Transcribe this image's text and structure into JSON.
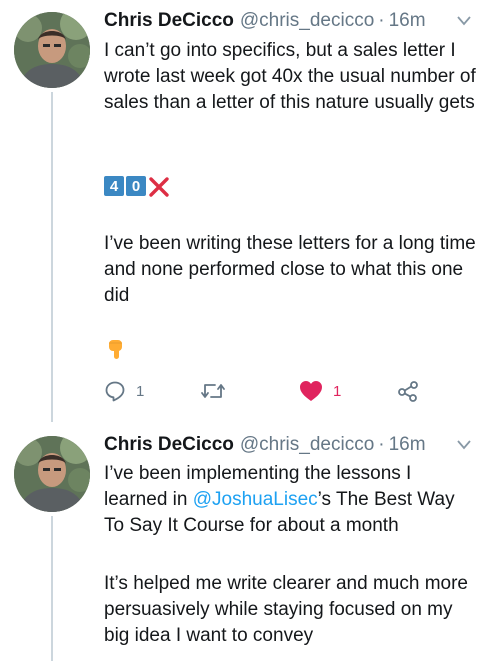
{
  "tweets": [
    {
      "name": "Chris DeCicco",
      "handle": "@chris_decicco",
      "separator": "·",
      "time": "16m",
      "paragraphs": [
        "I can’t go into specifics, but a sales letter I wrote last week got 40x the usual number of sales than a letter of this nature usually gets",
        "I’ve been writing these letters for a long time and none performed close to what this one did"
      ],
      "emoji_keycaps": [
        "4",
        "0"
      ],
      "emoji_cross": "❌",
      "emoji_pointing": "👇",
      "actions": {
        "reply_count": "1",
        "retweet_count": "",
        "like_count": "1"
      },
      "colors": {
        "like": "#e0245e",
        "icon": "#657786"
      }
    },
    {
      "name": "Chris DeCicco",
      "handle": "@chris_decicco",
      "separator": "·",
      "time": "16m",
      "text_before_mention": "I’ve been implementing the lessons I learned in ",
      "mention": "@JoshuaLisec",
      "text_after_mention": "’s The Best Way To Say It Course for about a month",
      "paragraph_2": "It’s helped me write clearer and much more persuasively while staying focused on my big idea I want to convey"
    }
  ],
  "colors": {
    "link": "#1da1f2",
    "thread_line": "#ccd6dd",
    "secondary_text": "#657786"
  }
}
